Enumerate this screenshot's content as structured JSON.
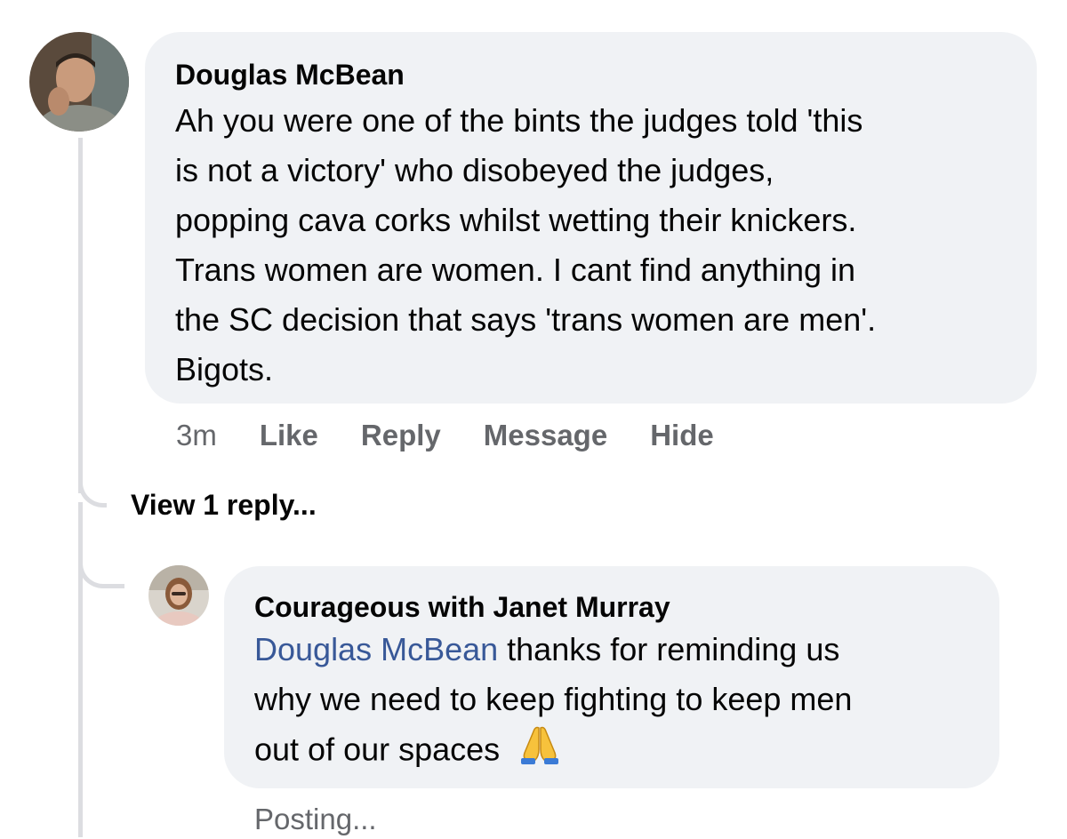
{
  "comment": {
    "author": "Douglas McBean",
    "text_lines": [
      "Ah you were one of the bints the judges told 'this",
      "is not a victory' who disobeyed the judges,",
      "popping cava corks whilst wetting their knickers.",
      "Trans women are women. I cant find anything in",
      "the SC decision that says 'trans women are men'.",
      "Bigots."
    ],
    "time": "3m",
    "actions": [
      "Like",
      "Reply",
      "Message",
      "Hide"
    ]
  },
  "view_replies": "View 1 reply...",
  "reply": {
    "author": "Courageous with Janet Murray",
    "mention": "Douglas McBean",
    "text_line_1_rest": " thanks for reminding us",
    "text_line_2": "why we need to keep fighting to keep men",
    "text_line_3": "out of our spaces",
    "emoji": "folded-hands-icon",
    "status": "Posting..."
  }
}
